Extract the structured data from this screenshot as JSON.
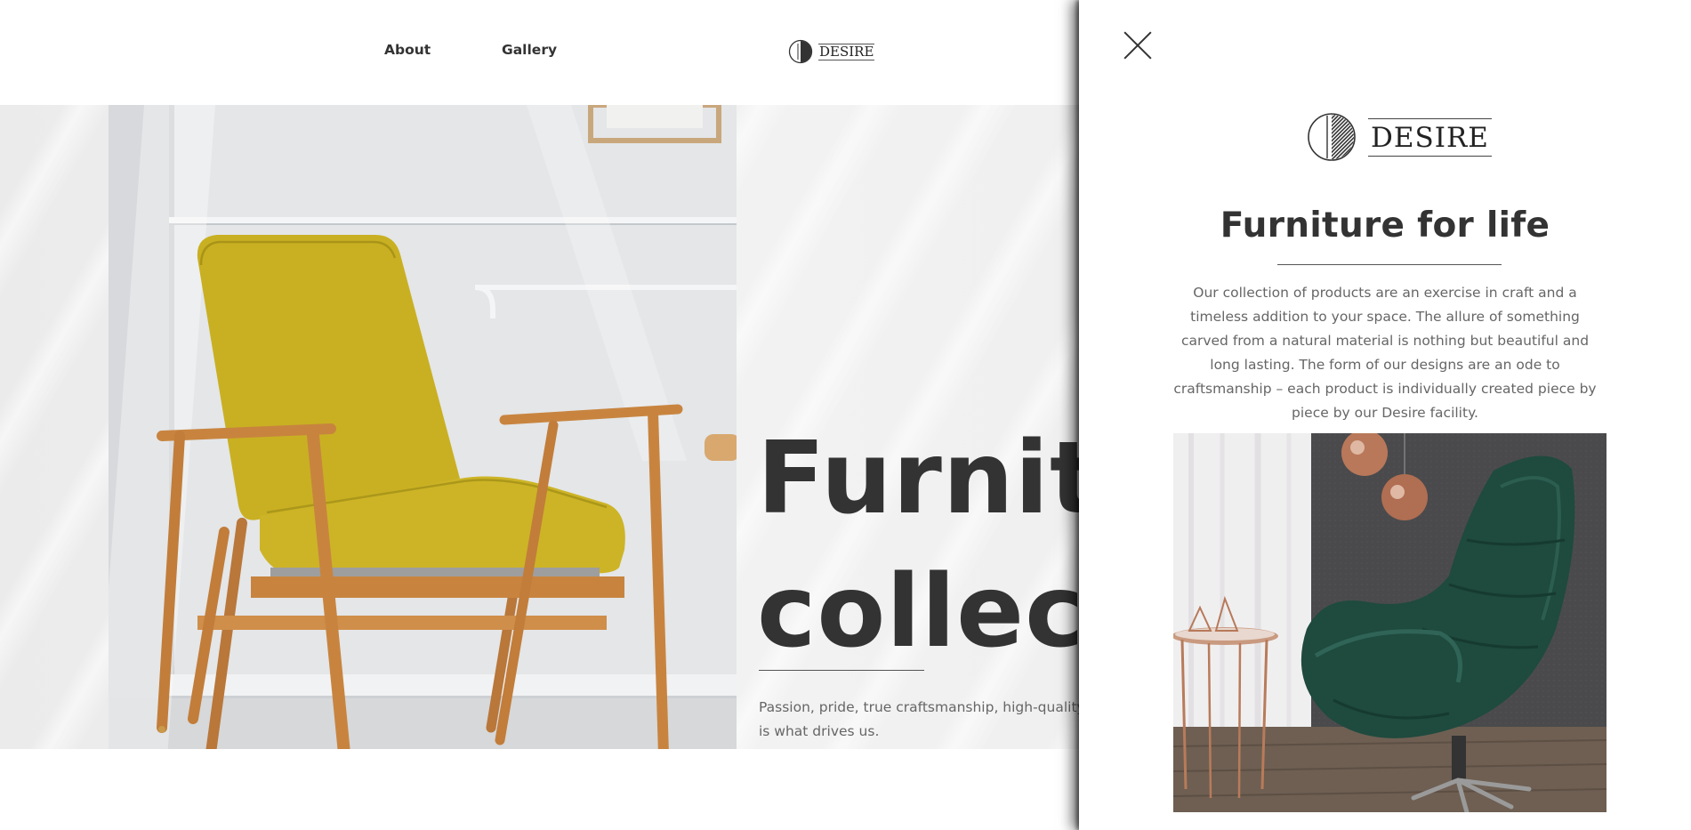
{
  "header": {
    "nav": [
      {
        "label": "About"
      },
      {
        "label": "Gallery"
      }
    ],
    "logo_text": "DESIRE"
  },
  "hero": {
    "title_line1": "Furnitu",
    "title_line2": "collect",
    "subtitle_line1": "Passion, pride, true craftsmanship, high-quality m",
    "subtitle_line2": "is what drives us.",
    "image_icon": "yellow-armchair-photo"
  },
  "panel": {
    "close_icon": "close-icon",
    "logo_text": "DESIRE",
    "title": "Furniture for life",
    "description": "Our collection of products are an exercise in craft and a timeless addition to your space. The allure of something carved from a natural material is nothing but beautiful and long lasting. The form of our designs are an ode to craftsmanship – each product is individually created piece by piece by our Desire facility.",
    "image_icon": "green-egg-chair-photo"
  },
  "colors": {
    "text_dark": "#333333",
    "text_muted": "#666666",
    "chair_yellow": "#c9b022",
    "chair_green": "#1f4a3e",
    "wood": "#c8843f"
  }
}
